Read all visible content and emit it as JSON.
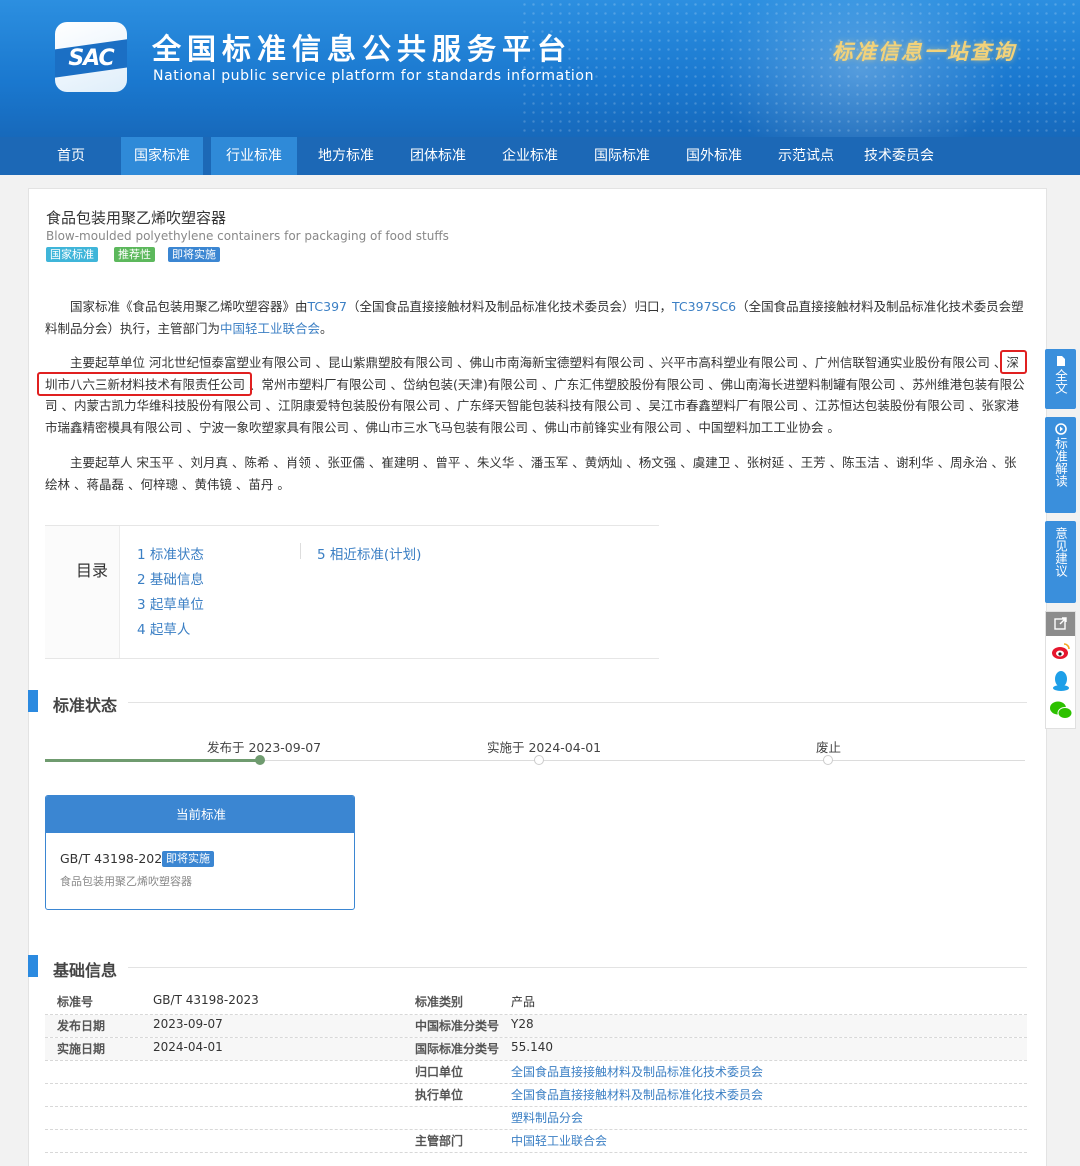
{
  "header": {
    "logo_text": "SAC",
    "title": "全国标准信息公共服务平台",
    "subtitle": "National public service platform  for standards information",
    "slogan": "标准信息一站查询"
  },
  "nav": {
    "items": [
      "首页",
      "国家标准",
      "行业标准",
      "地方标准",
      "团体标准",
      "企业标准",
      "国际标准",
      "国外标准",
      "示范试点",
      "技术委员会"
    ]
  },
  "standard": {
    "title": "食品包装用聚乙烯吹塑容器",
    "title_en": "Blow-moulded polyethylene containers for packaging of food stuffs",
    "tags": [
      "国家标准",
      "推荐性",
      "即将实施"
    ]
  },
  "intro": {
    "p1_a": "国家标准《食品包装用聚乙烯吹塑容器》由",
    "p1_link1": "TC397",
    "p1_b": "（全国食品直接接触材料及制品标准化技术委员会）归口，",
    "p1_link2": "TC397SC6",
    "p1_c": "（全国食品直接接触材料及制品标准化技术委员会塑料制品分会）执行，主管部门为",
    "p1_link3": "中国轻工业联合会",
    "p1_d": "。",
    "units_label": "主要起草单位",
    "units_a": "河北世纪恒泰富塑业有限公司 、昆山紫鼎塑胶有限公司 、佛山市南海新宝德塑料有限公司 、兴平市高科塑业有限公司 、广州信联智通实业股份有限公司 、",
    "units_hl": "深圳市八六三新材料技术有限责任公司",
    "units_b": " 、常州市塑料厂有限公司 、岱纳包装(天津)有限公司 、广东汇伟塑胶股份有限公司 、佛山南海长进塑料制罐有限公司 、苏州维港包装有限公司 、内蒙古凯力华维科技股份有限公司 、江阴康爱特包装股份有限公司 、广东绎天智能包装科技有限公司 、吴江市春鑫塑料厂有限公司 、江苏恒达包装股份有限公司 、张家港市瑞鑫精密模具有限公司 、宁波一象吹塑家具有限公司 、佛山市三水飞马包装有限公司 、佛山市前锋实业有限公司 、中国塑料加工工业协会 。",
    "people_label": "主要起草人",
    "people": "宋玉平 、刘月真 、陈希 、肖领 、张亚儒 、崔建明 、曾平 、朱义华 、潘玉军 、黄炳灿 、杨文强 、虞建卫 、张树延 、王芳 、陈玉洁 、谢利华 、周永治 、张绘林 、蒋晶磊 、何梓璁 、黄伟镜 、苗丹 。"
  },
  "toc": {
    "label": "目录",
    "items": [
      "1 标准状态",
      "2 基础信息",
      "3 起草单位",
      "4 起草人",
      "5 相近标准(计划)"
    ]
  },
  "status": {
    "heading": "标准状态",
    "steps": [
      "发布于 2023-09-07",
      "实施于 2024-04-01",
      "废止"
    ],
    "current_head": "当前标准",
    "current_code": "GB/T 43198-2023",
    "current_tag": "即将实施",
    "current_name": "食品包装用聚乙烯吹塑容器"
  },
  "basic": {
    "heading": "基础信息",
    "left": [
      {
        "label": "标准号",
        "value": "GB/T 43198-2023"
      },
      {
        "label": "发布日期",
        "value": "2023-09-07"
      },
      {
        "label": "实施日期",
        "value": "2024-04-01"
      }
    ],
    "right": [
      {
        "label": "标准类别",
        "value": "产品"
      },
      {
        "label": "中国标准分类号",
        "value": "Y28"
      },
      {
        "label": "国际标准分类号",
        "value": "55.140"
      },
      {
        "label": "归口单位",
        "value": "全国食品直接接触材料及制品标准化技术委员会"
      },
      {
        "label": "执行单位",
        "value": "全国食品直接接触材料及制品标准化技术委员会"
      },
      {
        "label": "",
        "value": "塑料制品分会"
      },
      {
        "label": "主管部门",
        "value": "中国轻工业联合会"
      }
    ]
  },
  "side": {
    "buttons": [
      "全文",
      "标准解读",
      "意见建议"
    ]
  },
  "colors": {
    "brand_blue": "#1c68b6",
    "link": "#3b7fc4",
    "tag_cyan": "#3fb5d9",
    "tag_green": "#5cb85c",
    "tag_blue": "#3b86d2",
    "highlight": "#e02020"
  }
}
